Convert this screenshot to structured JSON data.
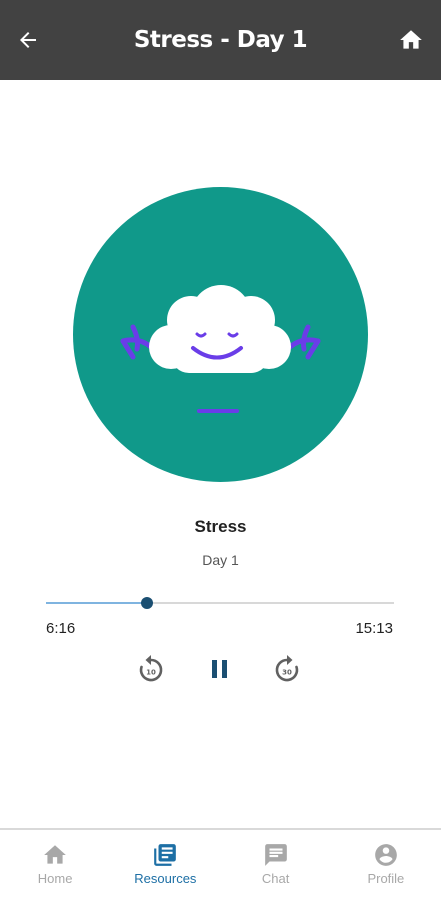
{
  "header": {
    "title": "Stress - Day 1",
    "back_icon": "arrow-left-icon",
    "home_icon": "home-icon"
  },
  "track": {
    "title": "Stress",
    "subtitle": "Day 1"
  },
  "player": {
    "elapsed": "6:16",
    "total": "15:13",
    "progress": 0.29,
    "rewind_label": "10",
    "forward_label": "30",
    "state": "playing"
  },
  "nav": {
    "items": [
      {
        "label": "Home",
        "icon": "home-icon",
        "active": false
      },
      {
        "label": "Resources",
        "icon": "newspaper-icon",
        "active": true
      },
      {
        "label": "Chat",
        "icon": "chat-icon",
        "active": false
      },
      {
        "label": "Profile",
        "icon": "account-circle-icon",
        "active": false
      }
    ]
  },
  "colors": {
    "header_bg": "#424242",
    "art_bg": "#10998a",
    "accent_purple": "#6a3de8",
    "active_nav": "#1d6fa5",
    "inactive_nav": "#a8a8a8",
    "progress_thumb": "#1b4f72"
  }
}
